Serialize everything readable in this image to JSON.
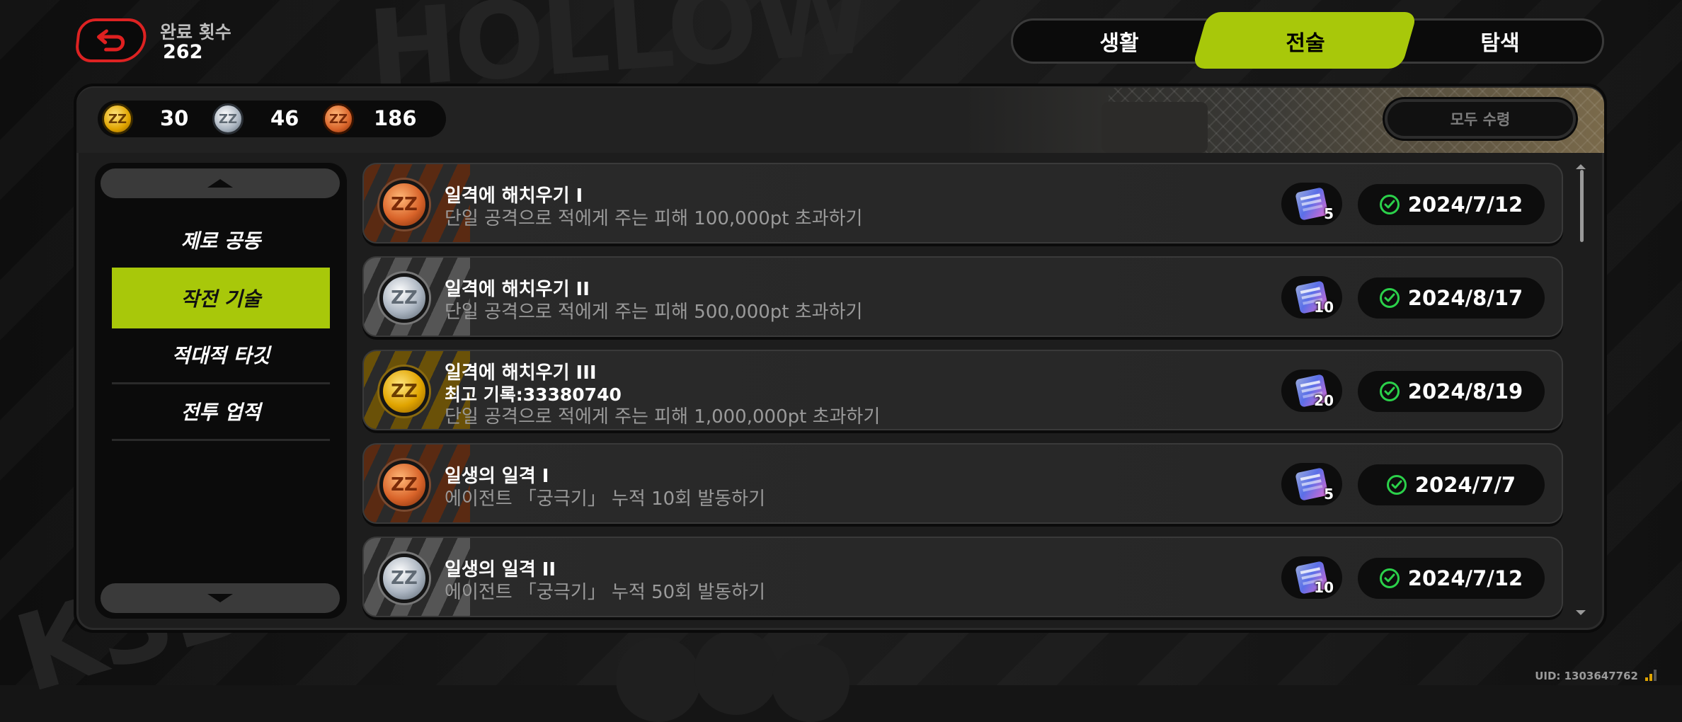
{
  "header": {
    "back_icon": "return-arrow-icon",
    "completion_label": "완료 횟수",
    "completion_count": "262"
  },
  "tabs": [
    {
      "label": "생활",
      "active": false
    },
    {
      "label": "전술",
      "active": true
    },
    {
      "label": "탐색",
      "active": false
    }
  ],
  "currency": [
    {
      "type": "gold",
      "value": "30"
    },
    {
      "type": "silver",
      "value": "46"
    },
    {
      "type": "bronze",
      "value": "186"
    }
  ],
  "claim_all_label": "모두 수령",
  "sidebar": {
    "items": [
      {
        "label": "제로 공동",
        "active": false
      },
      {
        "label": "작전 기술",
        "active": true
      },
      {
        "label": "적대적 타깃",
        "active": false
      },
      {
        "label": "전투 업적",
        "active": false
      }
    ]
  },
  "achievements": [
    {
      "tier": "bronze",
      "title": "일격에 해치우기 I",
      "record": "",
      "desc": "단일 공격으로 적에게 주는 피해 100,000pt 초과하기",
      "reward_qty": "5",
      "date": "2024/7/12"
    },
    {
      "tier": "silver",
      "title": "일격에 해치우기 II",
      "record": "",
      "desc": "단일 공격으로 적에게 주는 피해 500,000pt 초과하기",
      "reward_qty": "10",
      "date": "2024/8/17"
    },
    {
      "tier": "gold",
      "title": "일격에 해치우기 III",
      "record": "최고 기록:33380740",
      "desc": "단일 공격으로 적에게 주는 피해 1,000,000pt 초과하기",
      "reward_qty": "20",
      "date": "2024/8/19"
    },
    {
      "tier": "bronze",
      "title": "일생의 일격 I",
      "record": "",
      "desc": "에이전트 「궁극기」 누적 10회 발동하기",
      "reward_qty": "5",
      "date": "2024/7/7"
    },
    {
      "tier": "silver",
      "title": "일생의 일격 II",
      "record": "",
      "desc": "에이전트 「궁극기」 누적 50회 발동하기",
      "reward_qty": "10",
      "date": "2024/7/12"
    }
  ],
  "footer": {
    "uid": "UID: 1303647762"
  },
  "colors": {
    "accent": "#a8c80a",
    "check": "#2bd14a",
    "back_border": "#dd2222"
  }
}
